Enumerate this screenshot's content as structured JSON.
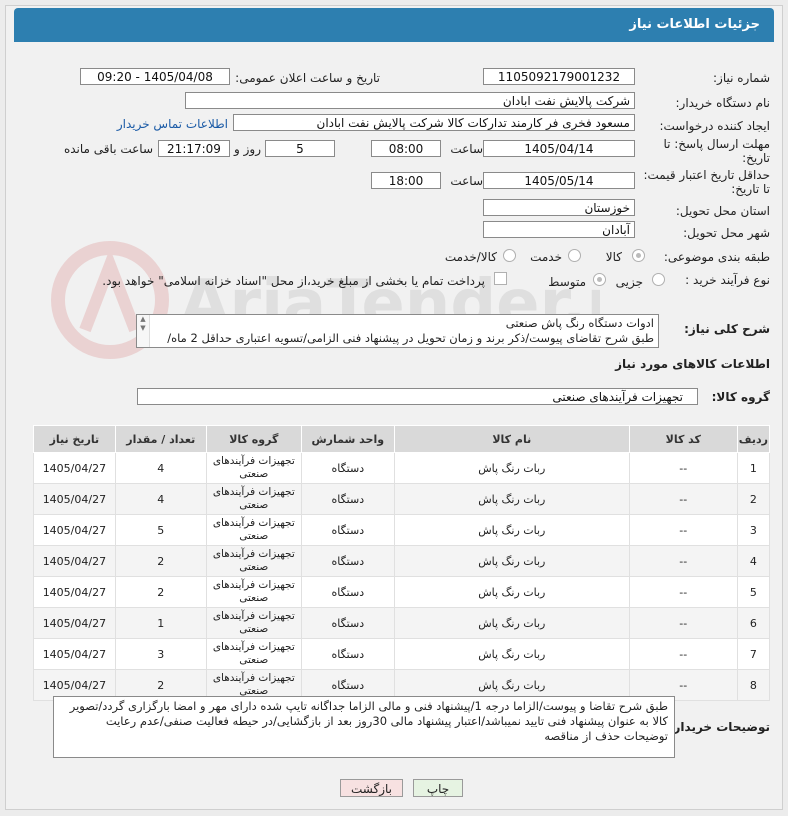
{
  "header": {
    "title": "جزئیات اطلاعات نیاز"
  },
  "watermark": {
    "text": "AriaTender.neT"
  },
  "fields": {
    "need_number": {
      "label": "شماره نیاز:",
      "value": "1105092179001232"
    },
    "announce_dt": {
      "label": "تاریخ و ساعت اعلان عمومی:",
      "value": "1405/04/08 - 09:20"
    },
    "buyer_org": {
      "label": "نام دستگاه خریدار:",
      "value": "شرکت پالایش نفت ابادان"
    },
    "requester": {
      "label": "ایجاد کننده درخواست:",
      "value": "مسعود فخری فر کارمند تدارکات کالا شرکت پالایش نفت ابادان",
      "contact_link": "اطلاعات تماس خریدار"
    },
    "reply_deadline": {
      "label_line1": "مهلت ارسال پاسخ: تا",
      "label_line2": "تاریخ:",
      "date": "1405/04/14",
      "time_label": "ساعت",
      "time": "08:00",
      "days": "5",
      "days_label": "روز و",
      "remaining": "21:17:09",
      "remaining_label": "ساعت باقی مانده"
    },
    "price_validity": {
      "label_line1": "حداقل تاریخ اعتبار قیمت:",
      "label_line2": "تا تاریخ:",
      "date": "1405/05/14",
      "time_label": "ساعت",
      "time": "18:00"
    },
    "province": {
      "label": "استان محل تحویل:",
      "value": "خوزستان"
    },
    "city": {
      "label": "شهر محل تحویل:",
      "value": "آبادان"
    },
    "category": {
      "label": "طبقه بندی موضوعی:",
      "options": [
        "کالا",
        "خدمت",
        "کالا/خدمت"
      ]
    },
    "process": {
      "label": "نوع فرآیند خرید :",
      "options": [
        "جزیی",
        "متوسط"
      ],
      "payment_note": "پرداخت تمام یا بخشی از مبلغ خرید،از محل \"اسناد خزانه اسلامی\" خواهد بود."
    }
  },
  "description": {
    "label": "شرح کلی نیاز:",
    "line1": "ادوات دستگاه رنگ پاش صنعتی",
    "line2": "طبق شرح تقاضای پیوست/ذکر برند و زمان تحویل در پیشنهاد فنی الزامی/تسویه اعتباری حداقل 2 ماه/"
  },
  "goods": {
    "title": "اطلاعات کالاهای مورد نیاز",
    "group_label": "گروه کالا:",
    "group_value": "تجهیزات فرآیندهای صنعتی",
    "columns": [
      "ردیف",
      "کد کالا",
      "نام کالا",
      "واحد شمارش",
      "گروه کالا",
      "تعداد / مقدار",
      "تاریخ نیاز"
    ],
    "rows": [
      {
        "n": "1",
        "code": "--",
        "name": "ربات رنگ پاش",
        "unit": "دستگاه",
        "group": "تجهیزات فرآیندهای صنعتی",
        "qty": "4",
        "date": "1405/04/27"
      },
      {
        "n": "2",
        "code": "--",
        "name": "ربات رنگ پاش",
        "unit": "دستگاه",
        "group": "تجهیزات فرآیندهای صنعتی",
        "qty": "4",
        "date": "1405/04/27"
      },
      {
        "n": "3",
        "code": "--",
        "name": "ربات رنگ پاش",
        "unit": "دستگاه",
        "group": "تجهیزات فرآیندهای صنعتی",
        "qty": "5",
        "date": "1405/04/27"
      },
      {
        "n": "4",
        "code": "--",
        "name": "ربات رنگ پاش",
        "unit": "دستگاه",
        "group": "تجهیزات فرآیندهای صنعتی",
        "qty": "2",
        "date": "1405/04/27"
      },
      {
        "n": "5",
        "code": "--",
        "name": "ربات رنگ پاش",
        "unit": "دستگاه",
        "group": "تجهیزات فرآیندهای صنعتی",
        "qty": "2",
        "date": "1405/04/27"
      },
      {
        "n": "6",
        "code": "--",
        "name": "ربات رنگ پاش",
        "unit": "دستگاه",
        "group": "تجهیزات فرآیندهای صنعتی",
        "qty": "1",
        "date": "1405/04/27"
      },
      {
        "n": "7",
        "code": "--",
        "name": "ربات رنگ پاش",
        "unit": "دستگاه",
        "group": "تجهیزات فرآیندهای صنعتی",
        "qty": "3",
        "date": "1405/04/27"
      },
      {
        "n": "8",
        "code": "--",
        "name": "ربات رنگ پاش",
        "unit": "دستگاه",
        "group": "تجهیزات فرآیندهای صنعتی",
        "qty": "2",
        "date": "1405/04/27"
      }
    ]
  },
  "buyer_notes": {
    "label": "توضیحات خریدار:",
    "line1": "طبق شرح تقاضا و پیوست/الزاما درجه 1/پیشنهاد فنی و مالی الزاما جداگانه تایپ شده دارای مهر و امضا بارگزاری گردد/تصویر",
    "line2": "کالا به عنوان پیشنهاد فنی تایید نمیباشد/اعتبار پیشنهاد مالی 30روز بعد از بازگشایی/در حیطه فعالیت صنفی/عدم رعایت",
    "line3": "توضیحات حذف از مناقصه"
  },
  "buttons": {
    "print": "چاپ",
    "back": "بازگشت"
  }
}
